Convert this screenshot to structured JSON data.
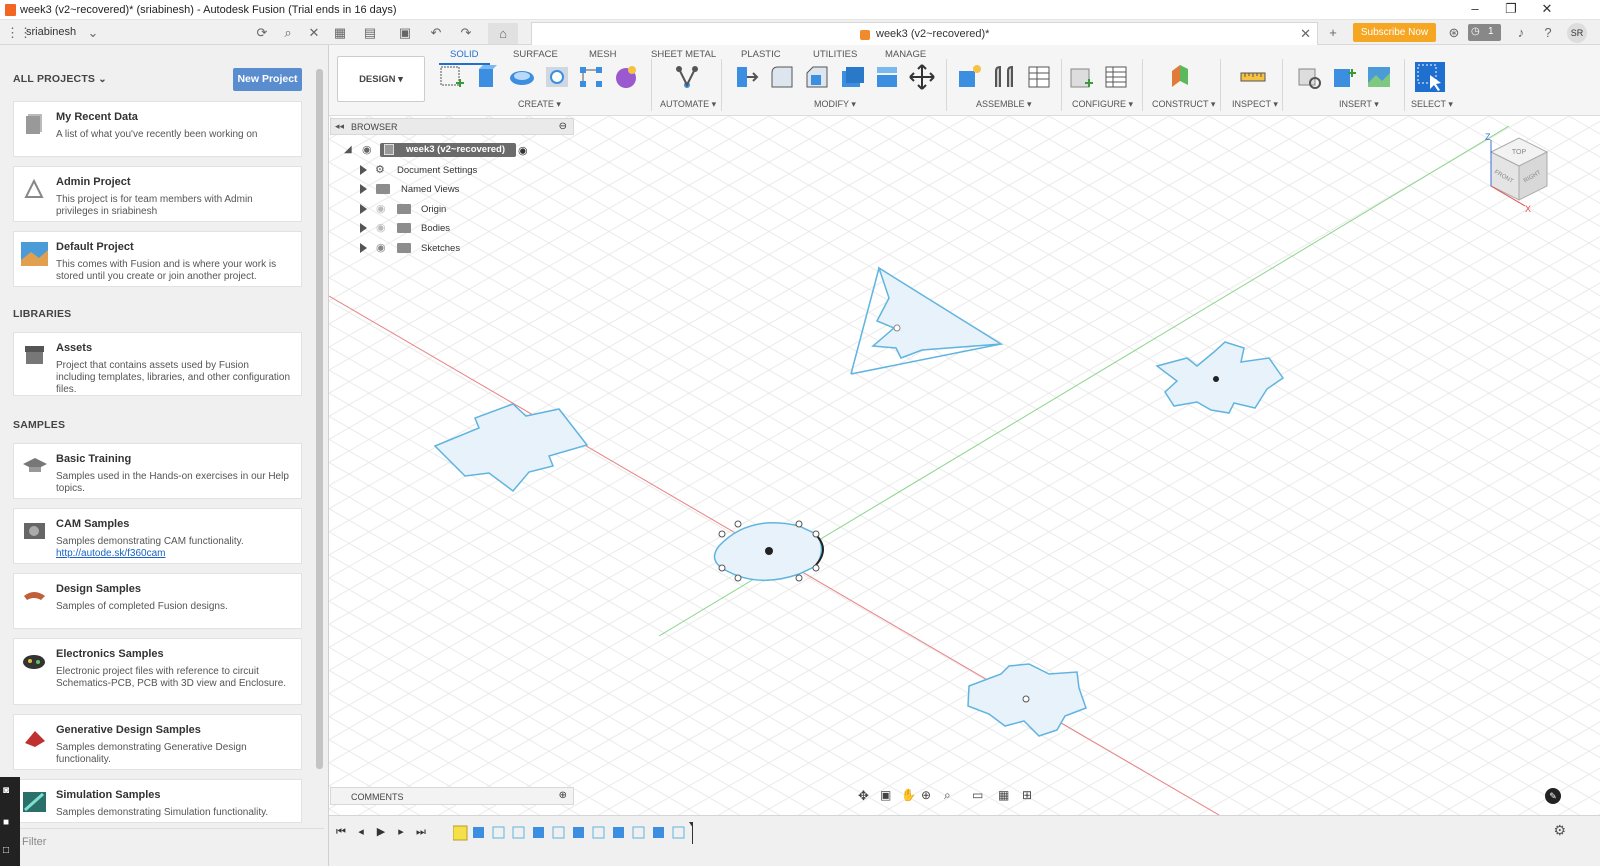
{
  "window": {
    "title": "week3 (v2~recovered)* (sriabinesh) - Autodesk Fusion (Trial ends in 16 days)"
  },
  "topbar": {
    "user": "sriabinesh",
    "document_tab": "week3 (v2~recovered)*",
    "subscribe_label": "Subscribe Now",
    "notification_count": "1",
    "avatar_initials": "SR"
  },
  "sidebar": {
    "all_projects_label": "ALL PROJECTS",
    "new_project_label": "New Project",
    "projects": [
      {
        "title": "My Recent Data",
        "desc": "A list of what you've recently been working on"
      },
      {
        "title": "Admin Project",
        "desc": "This project is for team members with Admin privileges in sriabinesh"
      },
      {
        "title": "Default Project",
        "desc": "This comes with Fusion and is where your work is stored until you create or join another project."
      }
    ],
    "libraries_label": "LIBRARIES",
    "libraries": [
      {
        "title": "Assets",
        "desc": "Project that contains assets used by Fusion including templates, libraries, and other configuration files."
      }
    ],
    "samples_label": "SAMPLES",
    "samples": [
      {
        "title": "Basic Training",
        "desc": "Samples used in the Hands-on exercises in our Help topics."
      },
      {
        "title": "CAM Samples",
        "desc": "Samples demonstrating CAM functionality.",
        "link": "http://autode.sk/f360cam"
      },
      {
        "title": "Design Samples",
        "desc": "Samples of completed Fusion designs."
      },
      {
        "title": "Electronics Samples",
        "desc": "Electronic project files with reference to circuit Schematics-PCB, PCB with 3D view and Enclosure."
      },
      {
        "title": "Generative Design Samples",
        "desc": "Samples demonstrating Generative Design functionality."
      },
      {
        "title": "Simulation Samples",
        "desc": "Samples demonstrating Simulation functionality."
      }
    ],
    "filter_placeholder": "Filter"
  },
  "ribbon": {
    "workspace_label": "DESIGN",
    "tabs": [
      "SOLID",
      "SURFACE",
      "MESH",
      "SHEET METAL",
      "PLASTIC",
      "UTILITIES",
      "MANAGE"
    ],
    "groups": [
      "CREATE",
      "AUTOMATE",
      "MODIFY",
      "ASSEMBLE",
      "CONFIGURE",
      "CONSTRUCT",
      "INSPECT",
      "INSERT",
      "SELECT"
    ]
  },
  "browser": {
    "title": "BROWSER",
    "root": "week3 (v2~recovered)",
    "items": [
      "Document Settings",
      "Named Views",
      "Origin",
      "Bodies",
      "Sketches"
    ]
  },
  "comments_label": "COMMENTS",
  "viewcube": {
    "top": "TOP",
    "front": "FRONT",
    "right": "RIGHT",
    "z": "Z",
    "x": "X"
  },
  "colors": {
    "accent_blue": "#1f6fd1",
    "subscribe_orange": "#f5a623",
    "sketch_blue": "#5fb4e0",
    "sketch_fill": "#e8f2fa",
    "axis_red": "#e88080",
    "axis_green": "#8bd48b"
  }
}
